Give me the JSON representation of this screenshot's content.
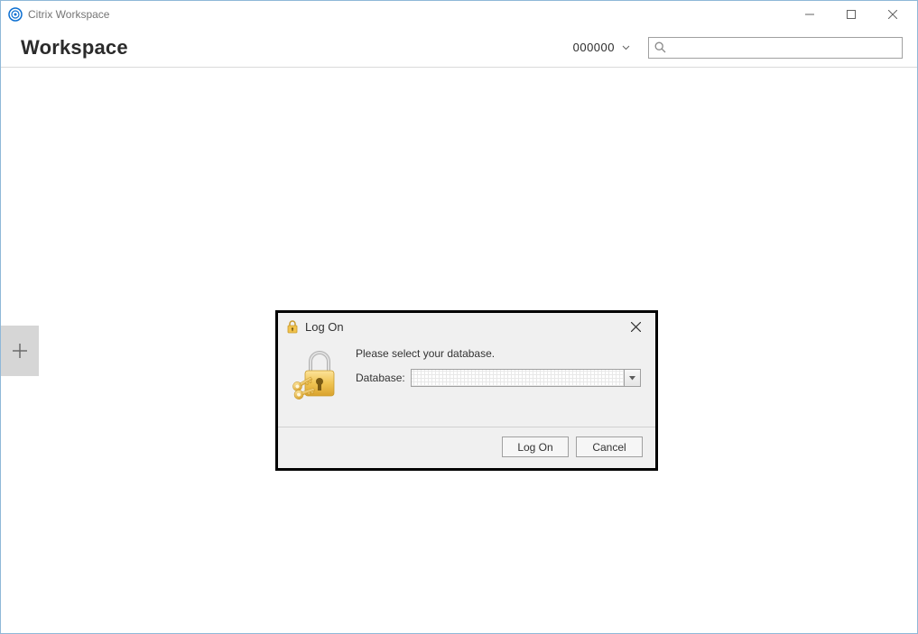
{
  "window": {
    "title": "Citrix Workspace"
  },
  "toolbar": {
    "workspace_label": "Workspace",
    "user_code": "000000"
  },
  "dialog": {
    "title": "Log On",
    "instruction": "Please select your database.",
    "field_label": "Database:",
    "field_value": "",
    "logon_label": "Log On",
    "cancel_label": "Cancel"
  }
}
